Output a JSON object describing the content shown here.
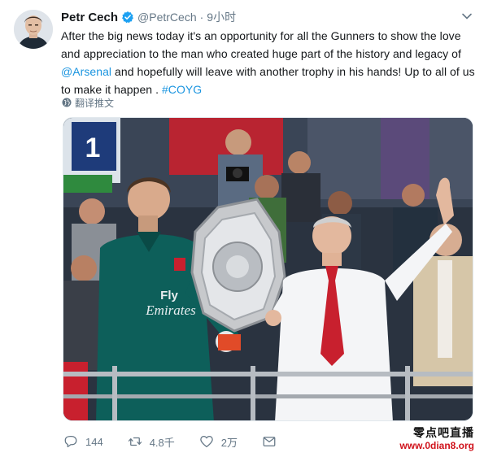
{
  "user": {
    "name": "Petr Cech",
    "handle": "@PetrCech",
    "separator": "·",
    "time": "9小时"
  },
  "tweet": {
    "line1": "After the big news today it's an opportunity for all the Gunners to show the love",
    "line2": "and appreciation to the man who created huge part of the history and legacy of",
    "line3_mention": "@Arsenal",
    "line3_rest": " and hopefully will leave with another trophy in his hands! Up to all of us",
    "line4_start": "to make it happen . ",
    "line4_hashtag": "#COYG"
  },
  "translate": {
    "label": "翻译推文"
  },
  "actions": {
    "reply_count": "144",
    "retweet_count": "4.8千",
    "like_count": "2万"
  },
  "watermark": {
    "top": "零点吧直播",
    "bottom": "www.0dian8.org"
  },
  "photo": {
    "shirt_sponsor_line1": "Fly",
    "shirt_sponsor_line2": "Emirates",
    "stand_number": "1"
  },
  "colors": {
    "link": "#1b95e0",
    "verified": "#1da1f2",
    "secondary_text": "#657786"
  },
  "icons": {
    "verified": "verified-badge-icon",
    "caret": "chevron-down-icon",
    "translate": "globe-icon",
    "reply": "reply-icon",
    "retweet": "retweet-icon",
    "like": "heart-icon",
    "message": "envelope-icon"
  }
}
